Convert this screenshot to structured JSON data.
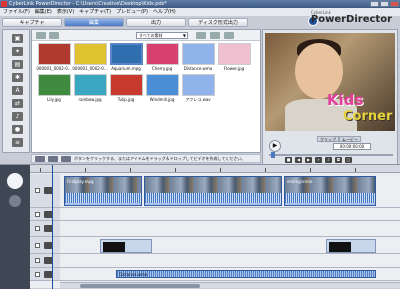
{
  "window": {
    "title": "CyberLink PowerDirector - C:\\Users\\Creative\\Desktop\\Kids.pds*"
  },
  "logo": {
    "brand": "CyberLink",
    "product": "PowerDirector"
  },
  "menu": [
    "ファイル(F)",
    "編集(E)",
    "表示(V)",
    "キャプチャ(T)",
    "プレビュー(P)",
    "ヘルプ(H)"
  ],
  "mode_tabs": [
    {
      "label": "キャプチャ",
      "active": false
    },
    {
      "label": "編集",
      "active": true
    },
    {
      "label": "出力",
      "active": false
    },
    {
      "label": "ディスク形式出力",
      "active": false
    }
  ],
  "library": {
    "filter": "すべての素材",
    "items": [
      {
        "label": "000001_0002-0...",
        "color": "#b03a2e"
      },
      {
        "label": "000001_0002-0...",
        "color": "#e0c230"
      },
      {
        "label": "Aquarium.mpg",
        "color": "#2f6fb0"
      },
      {
        "label": "Cherry.jpg",
        "color": "#d84070"
      },
      {
        "label": "Distance.wma",
        "color": "#8fb3ea"
      },
      {
        "label": "Flower.jpg",
        "color": "#f0c0d0"
      },
      {
        "label": "Lily.jpg",
        "color": "#3e8a3e"
      },
      {
        "label": "rainbow.jpg",
        "color": "#3aa6c0"
      },
      {
        "label": "Tulip.jpg",
        "color": "#c83a2e"
      },
      {
        "label": "Windmill.jpg",
        "color": "#4a8ed6"
      },
      {
        "label": "アフレコ.wav",
        "color": "#8fb3ea"
      }
    ]
  },
  "preview": {
    "title_line1": "Kids",
    "title_line2": "Corner",
    "mode_clip": "クリップ",
    "mode_movie": "ムービー",
    "timecode": "00:00:00:00"
  },
  "hint": "ボタンをクリックする、またはアイテムをドラッグ＆ドロップしてビデオを作成してください。",
  "timeline": {
    "video_clips": [
      {
        "label": "Firstplay.mpg"
      },
      {
        "label": ""
      },
      {
        "label": "endingscene"
      }
    ],
    "audio_clip": "Distance.wma"
  }
}
